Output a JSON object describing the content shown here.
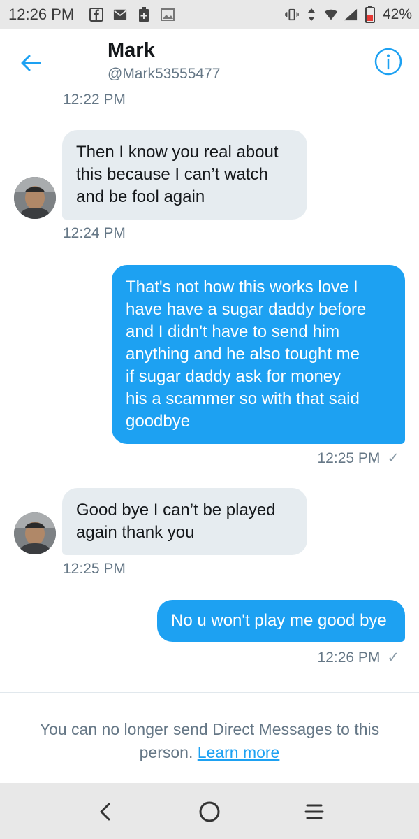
{
  "status_bar": {
    "time": "12:26 PM",
    "battery_percent": "42%",
    "icons_left": [
      "facebook-icon",
      "mail-icon",
      "plus-badge-icon",
      "image-icon"
    ],
    "icons_right": [
      "vibrate-icon",
      "data-arrows-icon",
      "wifi-icon",
      "signal-icon",
      "battery-icon"
    ]
  },
  "header": {
    "name": "Mark",
    "handle": "@Mark53555477"
  },
  "conversation": {
    "top_timestamp": "12:22 PM",
    "messages": [
      {
        "direction": "incoming",
        "lines": [
          "Then I know you real about",
          "this because I can’t watch",
          "and be fool again"
        ],
        "time": "12:24 PM"
      },
      {
        "direction": "outgoing",
        "lines": [
          "That's not how this works love I",
          "have have a sugar daddy before",
          "and I didn't have to send him",
          "anything and he also tought me",
          "if  sugar daddy ask for money",
          "his a scammer so with that said",
          "goodbye"
        ],
        "time": "12:25 PM",
        "read_mark": "✓"
      },
      {
        "direction": "incoming",
        "lines": [
          "Good bye I can’t be played",
          "again thank you"
        ],
        "time": "12:25 PM"
      },
      {
        "direction": "outgoing",
        "lines": [
          "No u won't play me good bye"
        ],
        "time": "12:26 PM",
        "read_mark": "✓"
      }
    ]
  },
  "notice": {
    "line1": "You can no longer send Direct Messages to this",
    "line2_prefix": "person. ",
    "link": "Learn more"
  },
  "colors": {
    "accent": "#1da1f2",
    "incoming_bubble": "#e6ecf0",
    "secondary_text": "#657786"
  }
}
